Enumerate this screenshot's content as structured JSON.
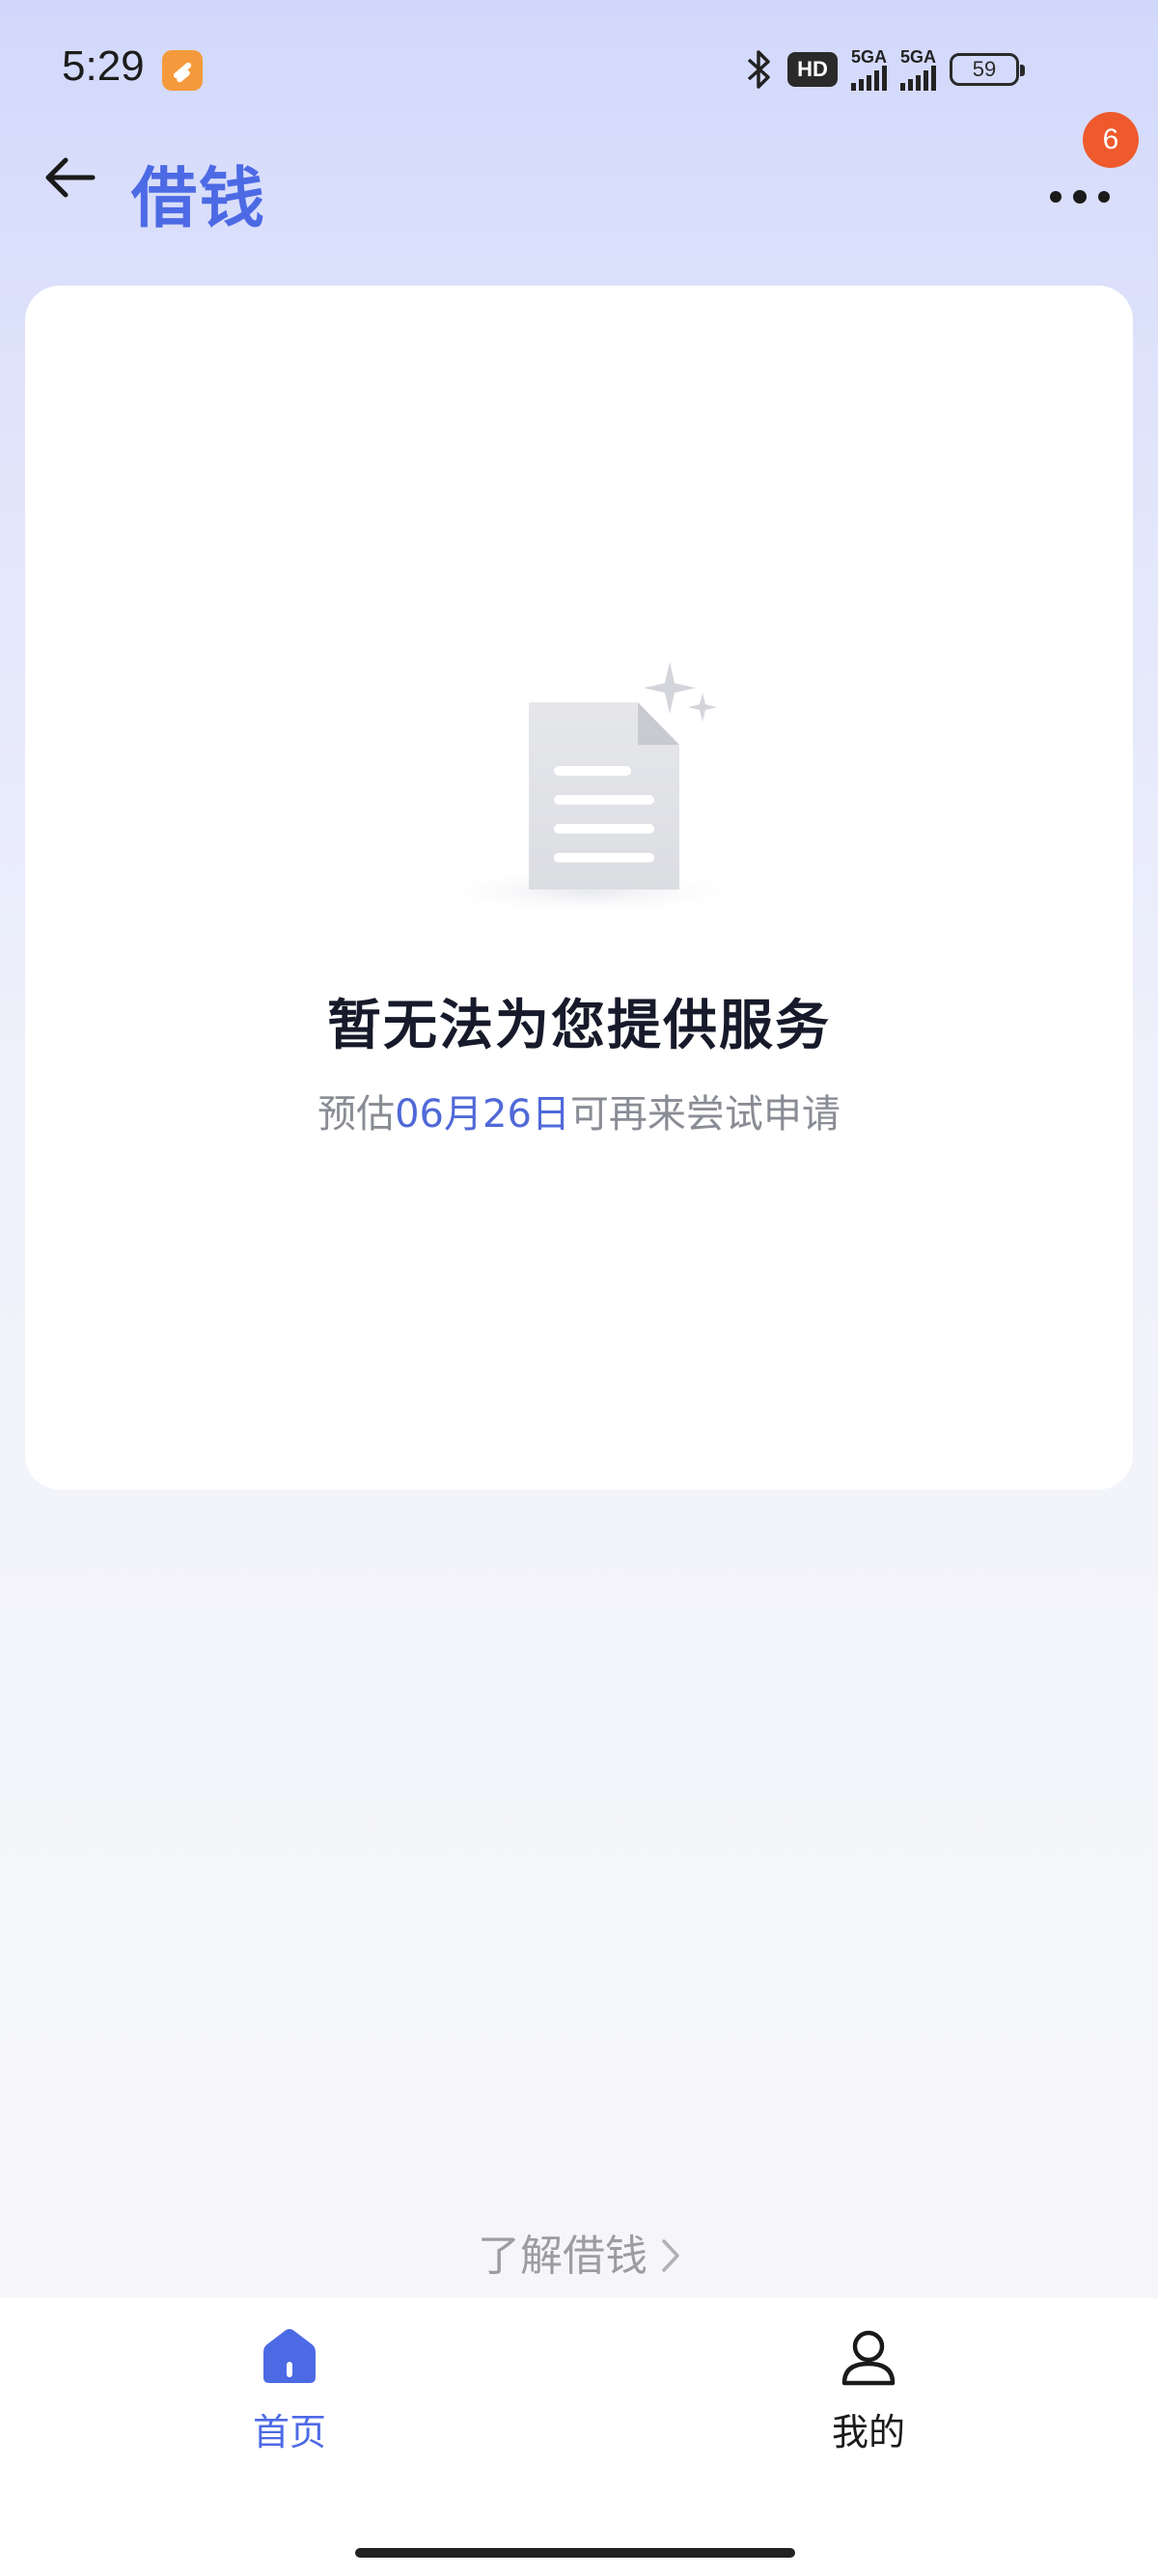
{
  "status_bar": {
    "time": "5:29",
    "hd_label": "HD",
    "signal_1_label": "5GA",
    "signal_2_label": "5GA",
    "battery_level": "59",
    "icons": [
      "app-notification-icon",
      "bluetooth-icon",
      "hd-voice-icon",
      "signal-icon",
      "battery-icon"
    ]
  },
  "header": {
    "title": "借钱",
    "badge_count": "6",
    "icons": [
      "back-arrow-icon",
      "more-icon"
    ]
  },
  "empty_state": {
    "title": "暂无法为您提供服务",
    "subtitle_prefix": "预估",
    "subtitle_date": "06月26日",
    "subtitle_suffix": "可再来尝试申请",
    "icon": "document-empty-icon"
  },
  "learn_link": {
    "label": "了解借钱",
    "icon": "chevron-right-icon"
  },
  "tab_bar": {
    "tabs": [
      {
        "label": "首页",
        "icon": "home-icon",
        "active": true
      },
      {
        "label": "我的",
        "icon": "user-icon",
        "active": false
      }
    ]
  },
  "colors": {
    "accent": "#4d6ae5",
    "badge": "#ee5a2c",
    "date_highlight": "#5069d8",
    "muted_text": "#8a8c95"
  }
}
